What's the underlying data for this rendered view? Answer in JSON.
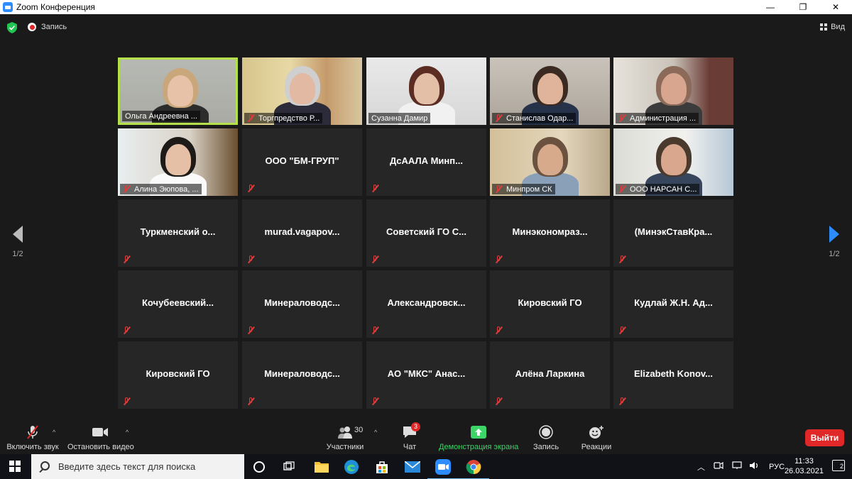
{
  "window": {
    "title": "Zoom Конференция",
    "minimize": "—",
    "restore": "❐",
    "close": "✕"
  },
  "meetbar": {
    "record_label": "Запись",
    "view_label": "Вид"
  },
  "pager": {
    "page": "1/2"
  },
  "participants": [
    {
      "name": "Ольга Андреевна ...",
      "video": true,
      "muted": false,
      "active": true
    },
    {
      "name": "Торгпредство Р...",
      "video": true,
      "muted": true
    },
    {
      "name": "Сузанна Дамир",
      "video": true,
      "muted": false
    },
    {
      "name": "Станислав Одар...",
      "video": true,
      "muted": true
    },
    {
      "name": "Администрация ...",
      "video": true,
      "muted": true
    },
    {
      "name": "Алина Эюпова, ...",
      "video": true,
      "muted": true
    },
    {
      "name": "ООО \"БМ-ГРУП\"",
      "video": false,
      "muted": true
    },
    {
      "name": "ДсААЛА  Минп...",
      "video": false,
      "muted": true
    },
    {
      "name": "Минпром СК",
      "video": true,
      "muted": true
    },
    {
      "name": "ООО НАРСАН С...",
      "video": true,
      "muted": true
    },
    {
      "name": "Туркменский  о...",
      "video": false,
      "muted": true
    },
    {
      "name": "murad.vagapov...",
      "video": false,
      "muted": true
    },
    {
      "name": "Советский  ГО  С...",
      "video": false,
      "muted": true
    },
    {
      "name": "Минэкономраз...",
      "video": false,
      "muted": true
    },
    {
      "name": "(МинэкСтавКра...",
      "video": false,
      "muted": true
    },
    {
      "name": "Кочубеевский...",
      "video": false,
      "muted": true
    },
    {
      "name": "Минераловодс...",
      "video": false,
      "muted": true
    },
    {
      "name": "Александровск...",
      "video": false,
      "muted": true
    },
    {
      "name": "Кировский ГО",
      "video": false,
      "muted": true
    },
    {
      "name": "Кудлай  Ж.Н.  Ад...",
      "video": false,
      "muted": true
    },
    {
      "name": "Кировский ГО",
      "video": false,
      "muted": true
    },
    {
      "name": "Минераловодс...",
      "video": false,
      "muted": true
    },
    {
      "name": "АО  \"МКС\"  Анас...",
      "video": false,
      "muted": true
    },
    {
      "name": "Алёна Ларкина",
      "video": false,
      "muted": true
    },
    {
      "name": "Elizabeth  Konov...",
      "video": false,
      "muted": true
    }
  ],
  "toolbar": {
    "audio_label": "Включить звук",
    "video_label": "Остановить видео",
    "participants_label": "Участники",
    "participants_count": "30",
    "chat_label": "Чат",
    "chat_badge": "3",
    "share_label": "Демонстрация экрана",
    "record_label": "Запись",
    "reactions_label": "Реакции",
    "leave_label": "Выйти"
  },
  "taskbar": {
    "search_placeholder": "Введите здесь текст для поиска",
    "lang": "РУС",
    "time": "11:33",
    "date": "26.03.2021",
    "notifications": "2"
  },
  "colors": {
    "accent": "#2d8cff",
    "active_speaker": "#b4e14a",
    "leave": "#e02828",
    "share": "#3dd468"
  }
}
